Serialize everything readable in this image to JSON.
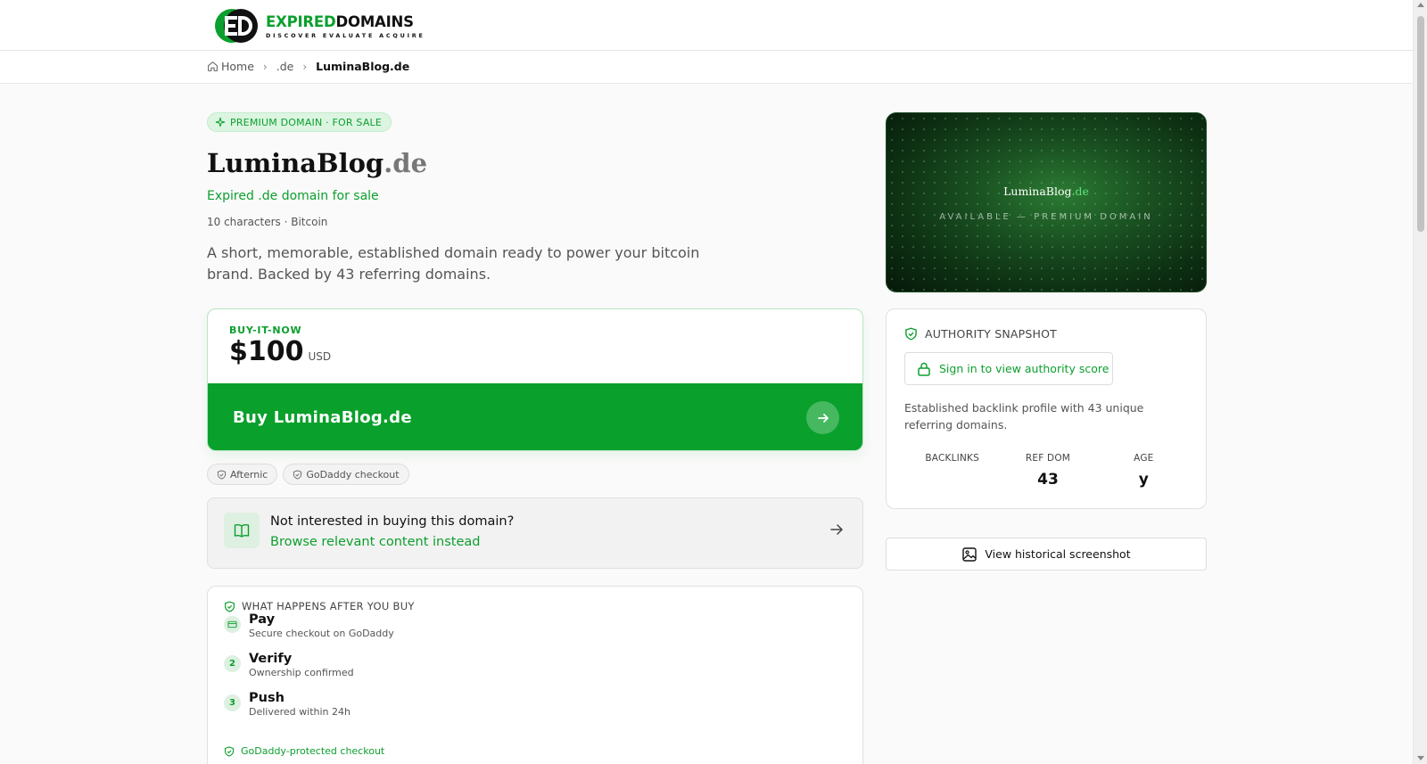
{
  "logo": {
    "title_accent": "EXPIRED",
    "title_rest": "DOMAINS",
    "tagline": "DISCOVER EVALUATE ACQUIRE",
    "mark_icon": "ed-logo-icon"
  },
  "breadcrumb": {
    "home": "Home",
    "tld": ".de",
    "current": "LuminaBlog.de"
  },
  "badge": "PREMIUM DOMAIN · FOR SALE",
  "domain": {
    "name": "LuminaBlog",
    "tld": ".de",
    "subtitle": "Expired .de domain for sale",
    "meta": "10 characters · Bitcoin",
    "description": "A short, memorable, established domain ready to power your bitcoin brand. Backed by 43 referring domains."
  },
  "buy": {
    "label": "BUY-IT-NOW",
    "price": "$100",
    "currency": "USD",
    "button": "Buy LuminaBlog.de"
  },
  "chips": [
    "Afternic",
    "GoDaddy checkout"
  ],
  "browse": {
    "question": "Not interested in buying this domain?",
    "link": "Browse relevant content instead"
  },
  "after": {
    "title": "WHAT HAPPENS AFTER YOU BUY",
    "steps": [
      {
        "num": "",
        "title": "Pay",
        "sub": "Secure checkout on GoDaddy"
      },
      {
        "num": "2",
        "title": "Verify",
        "sub": "Ownership confirmed"
      },
      {
        "num": "3",
        "title": "Push",
        "sub": "Delivered within 24h"
      }
    ],
    "footer": "GoDaddy-protected checkout"
  },
  "hero": {
    "name": "LuminaBlog",
    "tld": ".de",
    "caption": "AVAILABLE — PREMIUM DOMAIN"
  },
  "authority": {
    "title": "AUTHORITY SNAPSHOT",
    "signin": "Sign in to view authority score",
    "description": "Established backlink profile with 43 unique referring domains.",
    "stats": [
      {
        "label": "BACKLINKS",
        "value": ""
      },
      {
        "label": "REF DOM",
        "value": "43"
      },
      {
        "label": "AGE",
        "value": "y"
      }
    ]
  },
  "history_button": "View historical screenshot",
  "colors": {
    "brand_green": "#0c9f2e",
    "button_green": "#09a02b",
    "hero_dark": "#0d2f12"
  }
}
